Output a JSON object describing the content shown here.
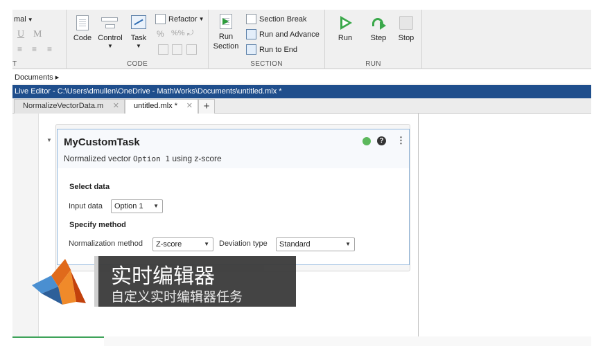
{
  "toolstrip": {
    "text_section": {
      "cut_label": "mal",
      "bold_u": "U",
      "bold_m": "M",
      "section_label": "T"
    },
    "code_section": {
      "label": "CODE",
      "code_button": "Code",
      "control_button": "Control",
      "task_button": "Task",
      "refactor_button": "Refactor",
      "percent_icon": "%",
      "comment_icon": "%%",
      "indent_icon": "⇥"
    },
    "section_section": {
      "label": "SECTION",
      "run_section": [
        "Run",
        "Section"
      ],
      "section_break": "Section Break",
      "run_and_advance": "Run and Advance",
      "run_to_end": "Run to End"
    },
    "run_section": {
      "label": "RUN",
      "run": "Run",
      "step": "Step",
      "stop": "Stop"
    }
  },
  "breadcrumb": {
    "text": "Documents ▸"
  },
  "window": {
    "title": "Live Editor - C:\\Users\\dmullen\\OneDrive - MathWorks\\Documents\\untitled.mlx *"
  },
  "tabs": [
    {
      "label": "NormalizeVectorData.m",
      "close": "✕"
    },
    {
      "label": "untitled.mlx *",
      "close": "✕"
    }
  ],
  "tab_add": "+",
  "task": {
    "title": "MyCustomTask",
    "summary_prefix": "Normalized vector ",
    "summary_code": "Option 1",
    "summary_suffix": " using z-score",
    "help_glyph": "?",
    "menu_glyph": "⋮",
    "status_color": "#5cb85c",
    "select_data_heading": "Select data",
    "input_data_label": "Input data",
    "input_data_value": "Option 1",
    "specify_method_heading": "Specify method",
    "normalization_label": "Normalization method",
    "normalization_value": "Z-score",
    "deviation_label": "Deviation type",
    "deviation_value": "Standard"
  },
  "overlay": {
    "title": "实时编辑器",
    "subtitle": "自定义实时编辑器任务"
  },
  "icons": {
    "run": "run-icon",
    "step": "step-icon",
    "stop": "stop-icon",
    "collapse": "collapse-arrow-icon"
  }
}
